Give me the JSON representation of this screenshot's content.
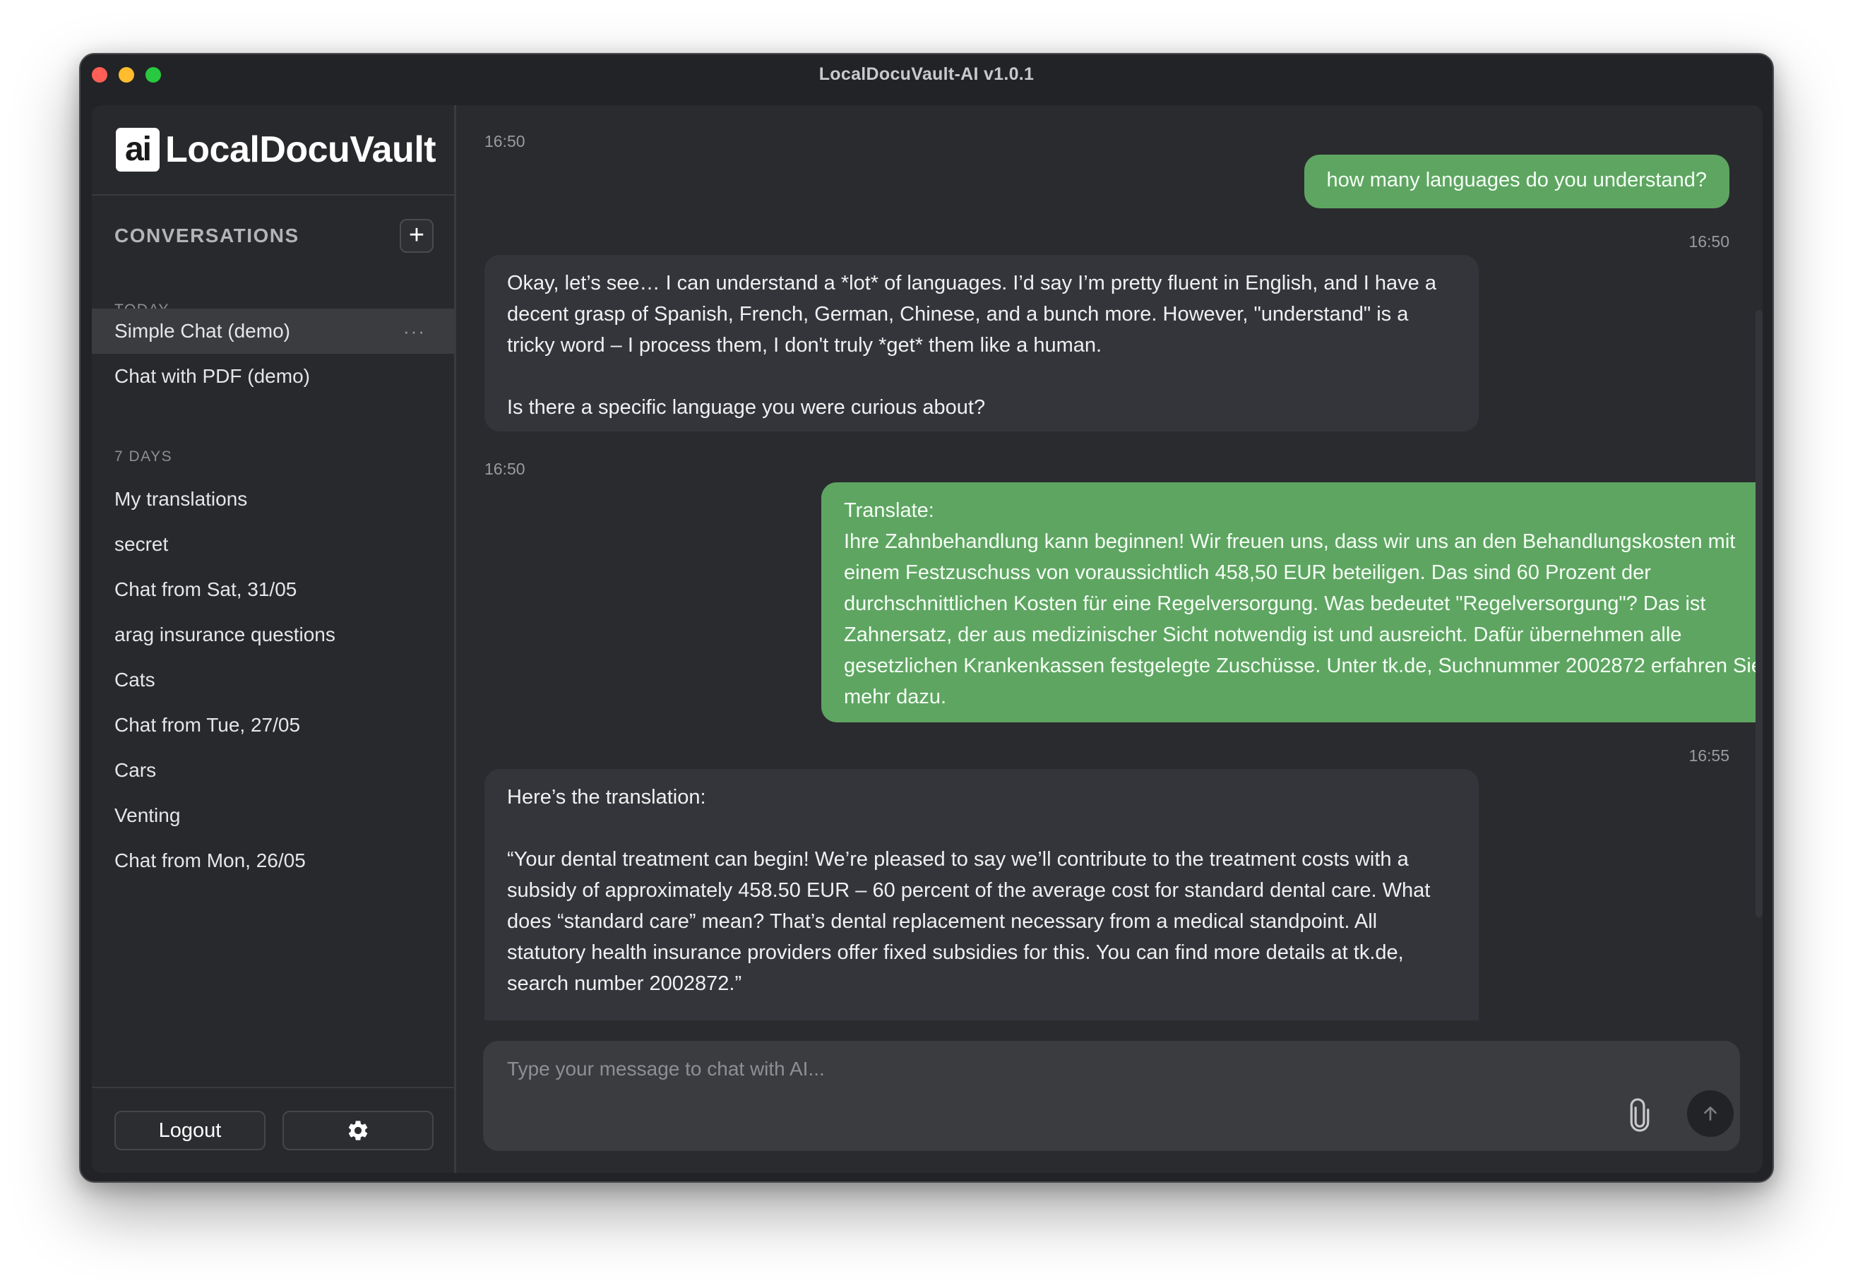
{
  "window": {
    "title": "LocalDocuVault-AI v1.0.1"
  },
  "logo": {
    "mark": "ai",
    "text": "LocalDocuVault"
  },
  "sidebar": {
    "conversations_title": "CONVERSATIONS",
    "add_label": "+",
    "sections": [
      {
        "label": "TODAY",
        "items": [
          {
            "label": "Simple Chat (demo)",
            "active": true
          },
          {
            "label": "Chat with PDF (demo)"
          }
        ]
      },
      {
        "label": "7 DAYS",
        "items": [
          {
            "label": "My translations"
          },
          {
            "label": "secret"
          },
          {
            "label": "Chat from Sat, 31/05"
          },
          {
            "label": "arag insurance questions"
          },
          {
            "label": "Cats"
          },
          {
            "label": "Chat from Tue, 27/05"
          },
          {
            "label": "Cars"
          },
          {
            "label": "Venting"
          },
          {
            "label": "Chat from Mon, 26/05"
          }
        ]
      }
    ],
    "more_label": "···",
    "logout_label": "Logout",
    "settings_icon": "gear-icon"
  },
  "chat": {
    "messages": [
      {
        "role": "user",
        "time": "16:50",
        "text": "how many languages do you understand?"
      },
      {
        "role": "ai",
        "time": "16:50",
        "text": "Okay, let’s see… I can understand a *lot* of languages. I’d say I’m pretty fluent in English, and I have a decent grasp of Spanish, French, German, Chinese, and a bunch more. However, \"understand\" is a tricky word – I process them, I don't truly *get* them like a human.\n\nIs there a specific language you were curious about?"
      },
      {
        "role": "user",
        "time": "16:50",
        "text": "Translate:\nIhre Zahnbehandlung kann beginnen! Wir freuen uns, dass wir uns an den Behandlungskosten mit einem Festzuschuss von voraussichtlich 458,50 EUR beteiligen. Das sind 60 Prozent der durchschnittlichen Kosten für eine Regelversorgung. Was bedeutet \"Regelversorgung\"? Das ist Zahnersatz, der aus medizinischer Sicht notwendig ist und ausreicht. Dafür übernehmen alle gesetzlichen Krankenkassen festgelegte Zuschüsse. Unter tk.de, Suchnummer 2002872 erfahren Sie mehr dazu."
      },
      {
        "role": "ai",
        "time": "16:55",
        "text": "Here’s the translation:\n\n“Your dental treatment can begin! We’re pleased to say we’ll contribute to the treatment costs with a subsidy of approximately 458.50 EUR – 60 percent of the average cost for standard dental care. What does “standard care” mean? That’s dental replacement necessary from a medical standpoint. All statutory health insurance providers offer fixed subsidies for this. You can find more details at tk.de, search number 2002872.”"
      }
    ]
  },
  "composer": {
    "placeholder": "Type your message to chat with AI...",
    "value": "",
    "attach_icon": "paperclip-icon",
    "send_icon": "arrow-up-icon"
  },
  "colors": {
    "user_bubble": "#5ea562",
    "ai_bubble": "#34353a",
    "background": "#2a2b2e"
  }
}
